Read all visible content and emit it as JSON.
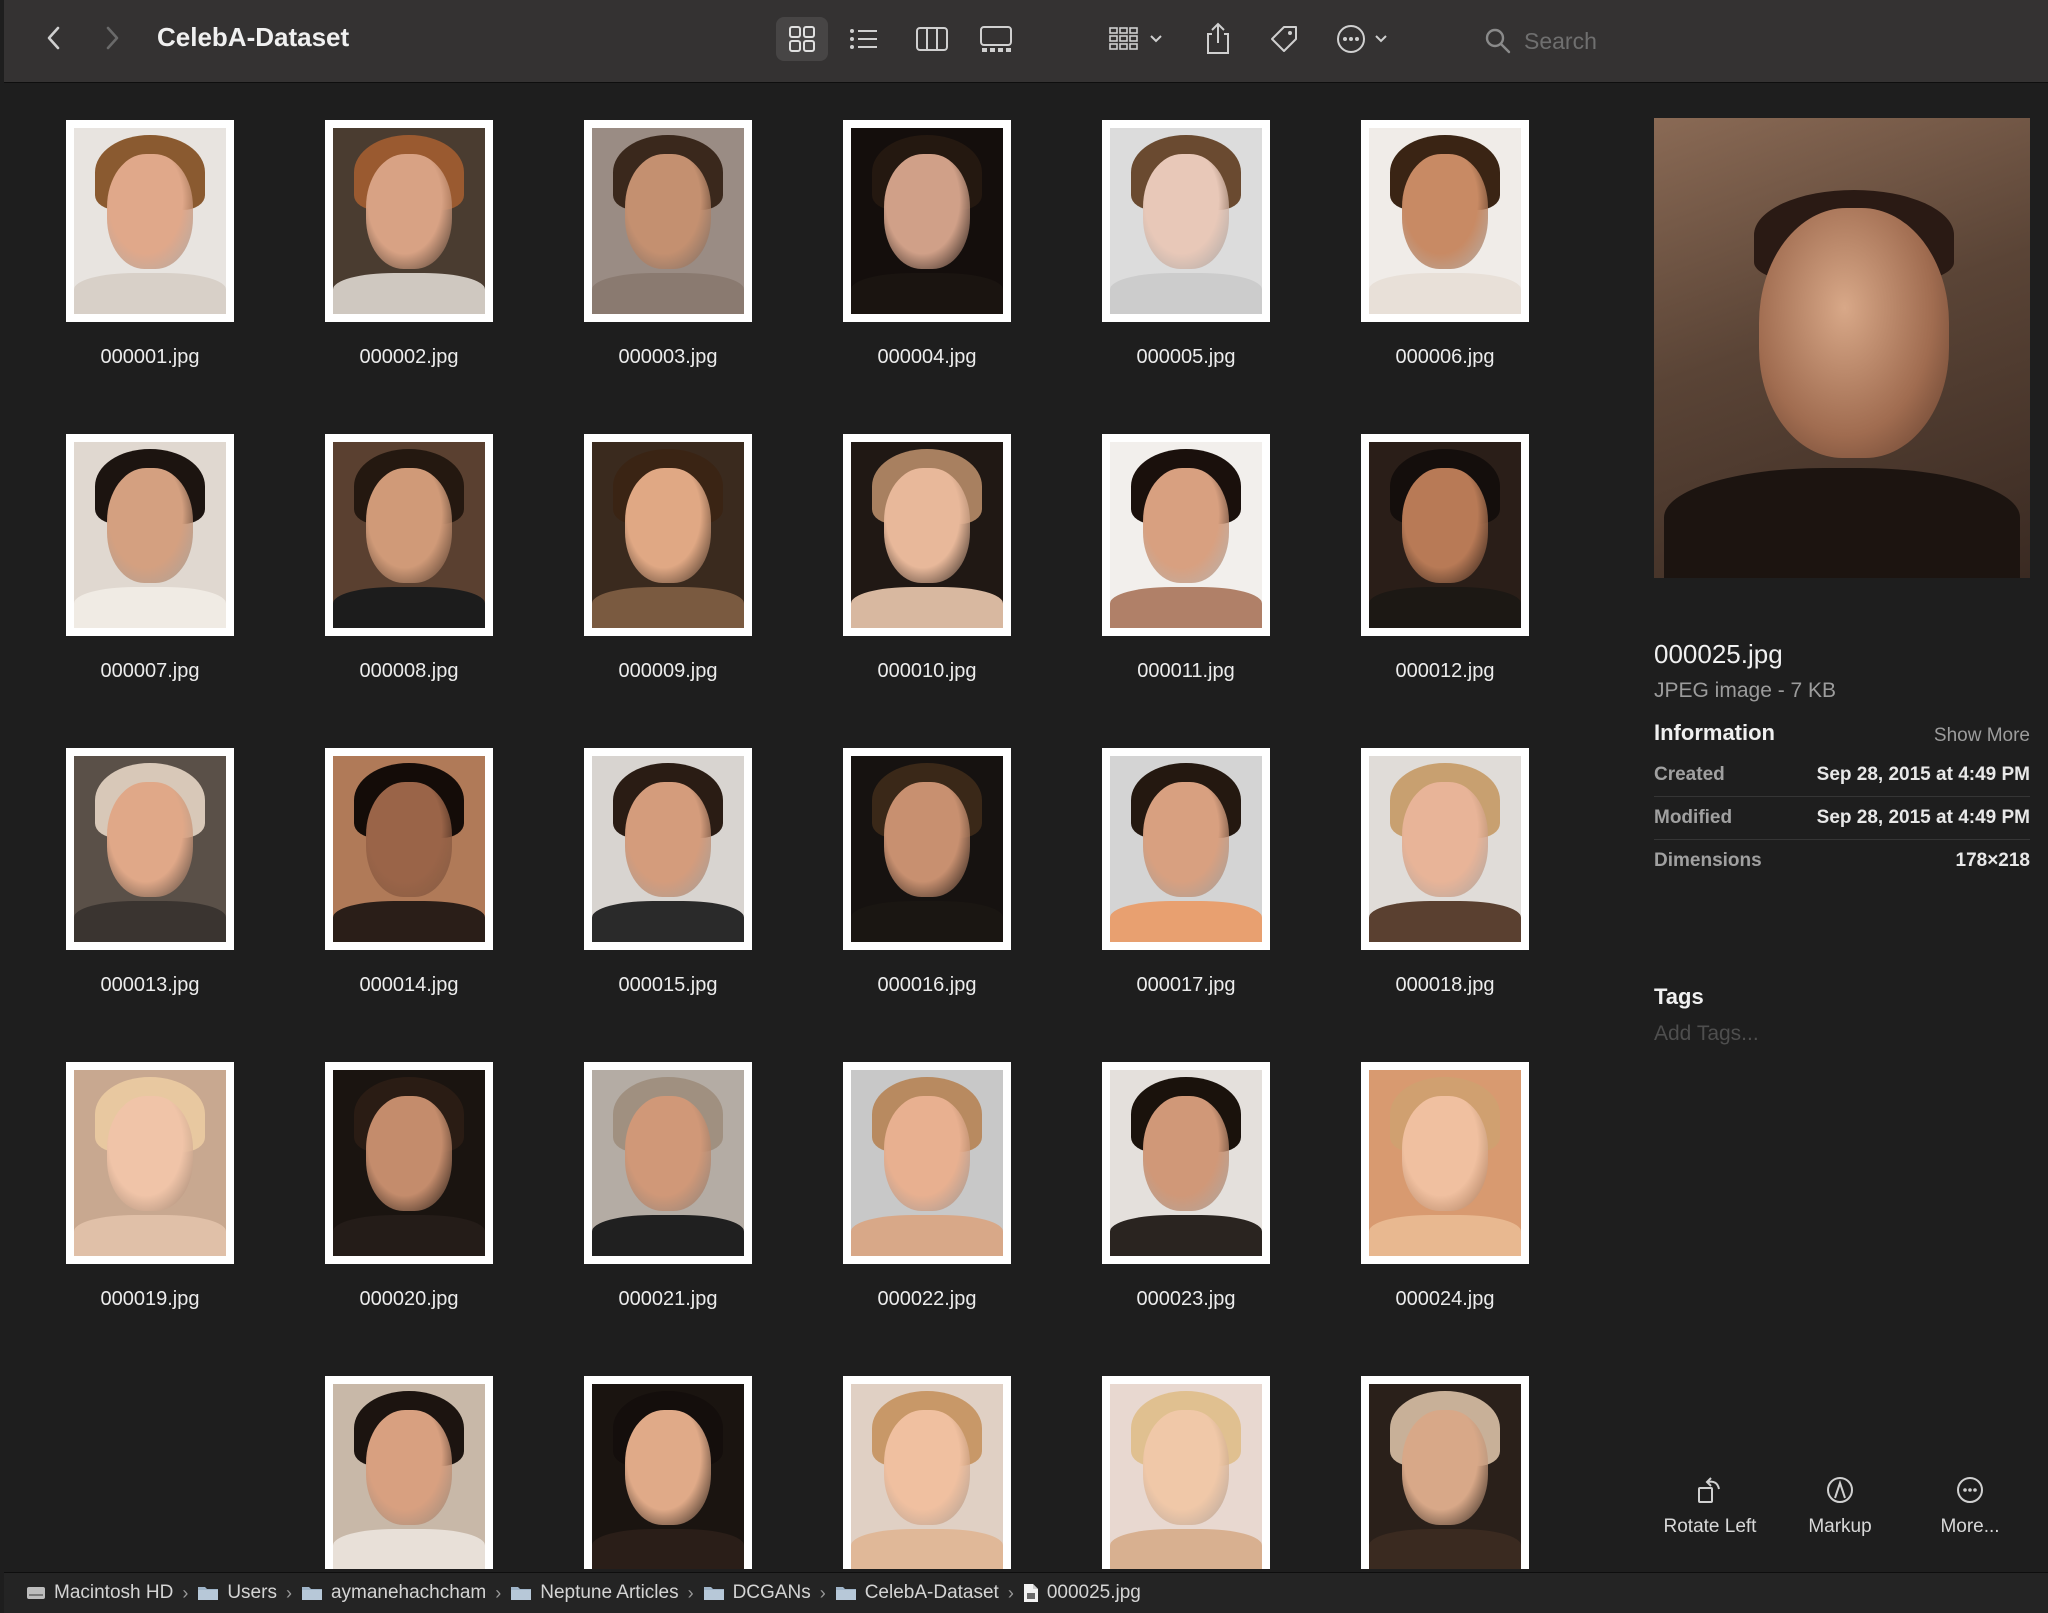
{
  "window": {
    "title": "CelebA-Dataset",
    "search_placeholder": "Search"
  },
  "toolbar": {
    "back_icon": "chevron-left-icon",
    "forward_icon": "chevron-right-icon",
    "view_icons": [
      "icon-view-icon",
      "list-view-icon",
      "column-view-icon",
      "gallery-view-icon"
    ],
    "active_view": "icon-view-icon",
    "other_icons": [
      "group-icon",
      "share-icon",
      "tag-icon",
      "more-icon"
    ]
  },
  "files": [
    {
      "name": "000001.jpg",
      "bg": "#e8e4e0",
      "skin": "#e0a88a",
      "hair": "#8a5a30",
      "cloth": "#d8d0c8"
    },
    {
      "name": "000002.jpg",
      "bg": "#4a3c30",
      "skin": "#d8a284",
      "hair": "#9a5a30",
      "cloth": "#cfc8c0"
    },
    {
      "name": "000003.jpg",
      "bg": "#9a8c84",
      "skin": "#c49070",
      "hair": "#3a281c",
      "cloth": "#8a7a70"
    },
    {
      "name": "000004.jpg",
      "bg": "#140e0c",
      "skin": "#d0a088",
      "hair": "#241810",
      "cloth": "#1a1410"
    },
    {
      "name": "000005.jpg",
      "bg": "#dcdcdc",
      "skin": "#e8c8b8",
      "hair": "#6a4a30",
      "cloth": "#cccccc"
    },
    {
      "name": "000006.jpg",
      "bg": "#f0ece8",
      "skin": "#c88a64",
      "hair": "#3a2414",
      "cloth": "#e8e0d8"
    },
    {
      "name": "000007.jpg",
      "bg": "#e0d8d0",
      "skin": "#d4a080",
      "hair": "#1c1410",
      "cloth": "#f0ebe4"
    },
    {
      "name": "000008.jpg",
      "bg": "#5a4030",
      "skin": "#d09a78",
      "hair": "#241810",
      "cloth": "#1c1c1c"
    },
    {
      "name": "000009.jpg",
      "bg": "#3a2a1e",
      "skin": "#e0a884",
      "hair": "#3a2414",
      "cloth": "#7a5a40"
    },
    {
      "name": "000010.jpg",
      "bg": "#201814",
      "skin": "#e8b89a",
      "hair": "#a88060",
      "cloth": "#d8b8a0"
    },
    {
      "name": "000011.jpg",
      "bg": "#f2efec",
      "skin": "#d8a080",
      "hair": "#1a100c",
      "cloth": "#b08068"
    },
    {
      "name": "000012.jpg",
      "bg": "#2a1e18",
      "skin": "#b87a56",
      "hair": "#140e0c",
      "cloth": "#1c1814"
    },
    {
      "name": "000013.jpg",
      "bg": "#5a5048",
      "skin": "#e0a888",
      "hair": "#d8c8b8",
      "cloth": "#3a3430"
    },
    {
      "name": "000014.jpg",
      "bg": "#b07a58",
      "skin": "#9a6448",
      "hair": "#140c08",
      "cloth": "#2a1e18"
    },
    {
      "name": "000015.jpg",
      "bg": "#d8d4d0",
      "skin": "#d49c7c",
      "hair": "#2a1c14",
      "cloth": "#2a2a2a"
    },
    {
      "name": "000016.jpg",
      "bg": "#161210",
      "skin": "#c89070",
      "hair": "#3a2818",
      "cloth": "#1a1612"
    },
    {
      "name": "000017.jpg",
      "bg": "#d4d4d4",
      "skin": "#d8a080",
      "hair": "#241810",
      "cloth": "#e8a070"
    },
    {
      "name": "000018.jpg",
      "bg": "#e0dcd8",
      "skin": "#e8b498",
      "hair": "#c8a070",
      "cloth": "#5a4030"
    },
    {
      "name": "000019.jpg",
      "bg": "#c8a890",
      "skin": "#f0c4a8",
      "hair": "#e8c8a0",
      "cloth": "#e0c0a8"
    },
    {
      "name": "000020.jpg",
      "bg": "#1a1410",
      "skin": "#c48c6c",
      "hair": "#2a1c14",
      "cloth": "#241c18"
    },
    {
      "name": "000021.jpg",
      "bg": "#b4aca4",
      "skin": "#d09878",
      "hair": "#a09080",
      "cloth": "#202020"
    },
    {
      "name": "000022.jpg",
      "bg": "#c8c8c8",
      "skin": "#e8b090",
      "hair": "#b88a60",
      "cloth": "#d8a888"
    },
    {
      "name": "000023.jpg",
      "bg": "#e4e0dc",
      "skin": "#d09878",
      "hair": "#1a120c",
      "cloth": "#2a2420"
    },
    {
      "name": "000024.jpg",
      "bg": "#d89a70",
      "skin": "#f0c0a0",
      "hair": "#d0a070",
      "cloth": "#e8b890"
    },
    {
      "name": "",
      "bg": "#c8b8a8",
      "skin": "#d8a080",
      "hair": "#1c1410",
      "cloth": "#e8e0d8"
    },
    {
      "name": "",
      "bg": "#1a1410",
      "skin": "#e0aa88",
      "hair": "#140e0c",
      "cloth": "#2a1e18"
    },
    {
      "name": "",
      "bg": "#e0d0c4",
      "skin": "#f0c0a0",
      "hair": "#c89868",
      "cloth": "#e0b898"
    },
    {
      "name": "",
      "bg": "#e8d8d0",
      "skin": "#f0c8a8",
      "hair": "#e0c090",
      "cloth": "#d8b090"
    },
    {
      "name": "",
      "bg": "#2a201a",
      "skin": "#d8a888",
      "hair": "#c8b098",
      "cloth": "#3a2a20"
    }
  ],
  "inspector": {
    "file_name": "000025.jpg",
    "kind": "JPEG image - 7 KB",
    "section_title": "Information",
    "show_more": "Show More",
    "info": [
      {
        "key": "Created",
        "value": "Sep 28, 2015 at 4:49 PM"
      },
      {
        "key": "Modified",
        "value": "Sep 28, 2015 at 4:49 PM"
      },
      {
        "key": "Dimensions",
        "value": "178×218"
      }
    ],
    "tags_title": "Tags",
    "tags_placeholder": "Add Tags...",
    "actions": [
      {
        "label": "Rotate Left",
        "icon": "rotate-left-icon"
      },
      {
        "label": "Markup",
        "icon": "markup-icon"
      },
      {
        "label": "More...",
        "icon": "more-icon"
      }
    ]
  },
  "path_bar": [
    {
      "label": "Macintosh HD",
      "icon": "drive-icon"
    },
    {
      "label": "Users",
      "icon": "folder-icon"
    },
    {
      "label": "aymanehachcham",
      "icon": "folder-icon"
    },
    {
      "label": "Neptune Articles",
      "icon": "folder-icon"
    },
    {
      "label": "DCGANs",
      "icon": "folder-icon"
    },
    {
      "label": "CelebA-Dataset",
      "icon": "folder-icon"
    },
    {
      "label": "000025.jpg",
      "icon": "file-icon"
    }
  ]
}
